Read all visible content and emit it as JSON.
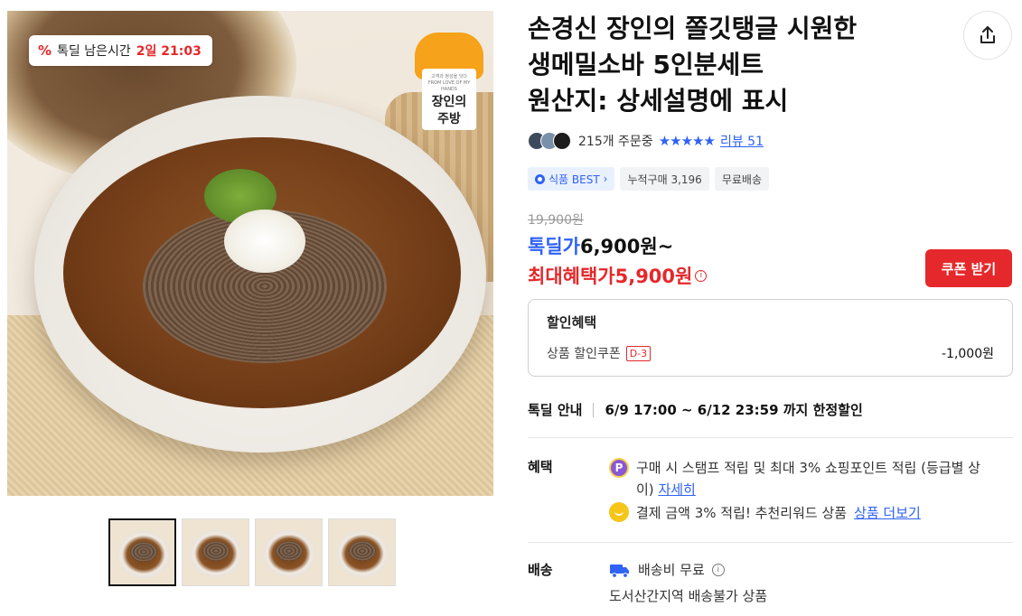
{
  "image": {
    "timer_badge": {
      "icon": "percent-icon",
      "icon_glyph": "%",
      "label": "톡딜 남은시간",
      "time": "2일 21:03"
    },
    "brand_logo": {
      "small_text": "고객과 정성을 잇다",
      "small_text_2": "FROM LOVE OF MY HANDS",
      "name_line1": "장인의",
      "name_line2": "주방"
    },
    "thumbnails": [
      {
        "alt": "thumbnail-1",
        "active": true
      },
      {
        "alt": "thumbnail-2",
        "active": false
      },
      {
        "alt": "thumbnail-3",
        "active": false
      },
      {
        "alt": "thumbnail-4",
        "active": false
      }
    ]
  },
  "product": {
    "title_line1": "손경신 장인의 쫄깃탱글 시원한",
    "title_line2": "생메밀소바 5인분세트",
    "title_line3": "원산지: 상세설명에 표시",
    "order_count": "215개 주문중",
    "stars": "★★★★★",
    "review_link": "리뷰 51",
    "tags": {
      "best": "식품 BEST",
      "best_chevron": "›",
      "cumulative": "누적구매 3,196",
      "free_ship": "무료배송"
    }
  },
  "price": {
    "original": "19,900원",
    "deal_label": "톡딜가",
    "deal_value": "6,900원~",
    "max_label": "최대혜택가",
    "max_value": "5,900원",
    "info_glyph": "i",
    "coupon_button": "쿠폰 받기"
  },
  "discount": {
    "heading": "할인혜택",
    "item_label": "상품 할인쿠폰",
    "dday": "D-3",
    "amount": "-1,000원"
  },
  "deal_info": {
    "label": "톡딜 안내",
    "period": "6/9 17:00 ~ 6/12 23:59 까지 한정할인"
  },
  "benefits": {
    "label": "혜택",
    "p_icon_glyph": "P",
    "line1": "구매 시 스탬프 적립 및 최대 3% 쇼핑포인트 적립 (등급별 상이)",
    "line1_link": "자세히",
    "line2": "결제 금액 3% 적립! 추천리워드 상품",
    "line2_link": "상품 더보기"
  },
  "shipping": {
    "label": "배송",
    "fee": "배송비 무료",
    "info_glyph": "i",
    "note": "도서산간지역 배송불가 상품"
  },
  "colors": {
    "accent_blue": "#2f62f5",
    "accent_red": "#e5282b",
    "brand_orange": "#f6a21a"
  }
}
